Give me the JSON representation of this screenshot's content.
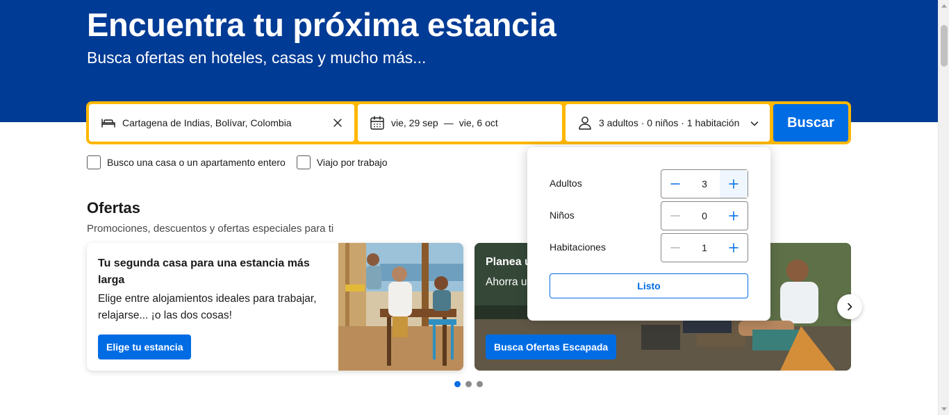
{
  "hero": {
    "title": "Encuentra tu próxima estancia",
    "subtitle": "Busca ofertas en hoteles, casas y mucho más..."
  },
  "search": {
    "destination_value": "Cartagena de Indias, Bolívar, Colombia",
    "check_in": "vie, 29 sep",
    "date_separator": "—",
    "check_out": "vie, 6 oct",
    "guests_summary": "3 adultos · 0 niños · 1 habitación",
    "search_label": "Buscar"
  },
  "filters": {
    "whole_home_label": "Busco una casa o un apartamento entero",
    "work_trip_label": "Viajo por trabajo",
    "whole_home_checked": false,
    "work_trip_checked": false
  },
  "offers": {
    "title": "Ofertas",
    "subtitle": "Promociones, descuentos y ofertas especiales para ti",
    "cards": [
      {
        "title": "Tu segunda casa para una estancia más larga",
        "body": "Elige entre alojamientos ideales para trabajar, relajarse... ¡o las dos cosas!",
        "button": "Elige tu estancia"
      },
      {
        "title": "Planea u",
        "body": "Ahorra u todo el m aventura",
        "button": "Busca Ofertas Escapada"
      }
    ],
    "carousel_pages": 3,
    "carousel_active": 1
  },
  "guests_popup": {
    "rows": [
      {
        "label": "Adultos",
        "value": "3"
      },
      {
        "label": "Niños",
        "value": "0"
      },
      {
        "label": "Habitaciones",
        "value": "1"
      }
    ],
    "done_label": "Listo"
  },
  "colors": {
    "brand_dark": "#003b95",
    "accent_yellow": "#ffb700",
    "action_blue": "#006ce4"
  }
}
